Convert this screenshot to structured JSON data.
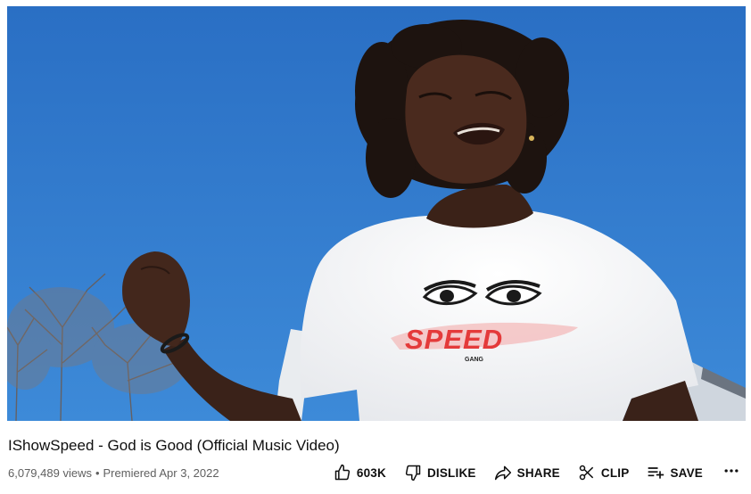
{
  "video": {
    "title": "IShowSpeed - God is Good (Official Music Video)",
    "views": "6,079,489 views",
    "separator": "•",
    "premiered": "Premiered Apr 3, 2022",
    "shirt_brand": "SPEED",
    "shirt_sub": "GANG"
  },
  "actions": {
    "like_count": "603K",
    "dislike_label": "DISLIKE",
    "share_label": "SHARE",
    "clip_label": "CLIP",
    "save_label": "SAVE"
  },
  "icons": {
    "like": "thumbs-up-icon",
    "dislike": "thumbs-down-icon",
    "share": "share-arrow-icon",
    "clip": "scissors-icon",
    "save": "playlist-add-icon",
    "more": "more-horizontal-icon"
  }
}
